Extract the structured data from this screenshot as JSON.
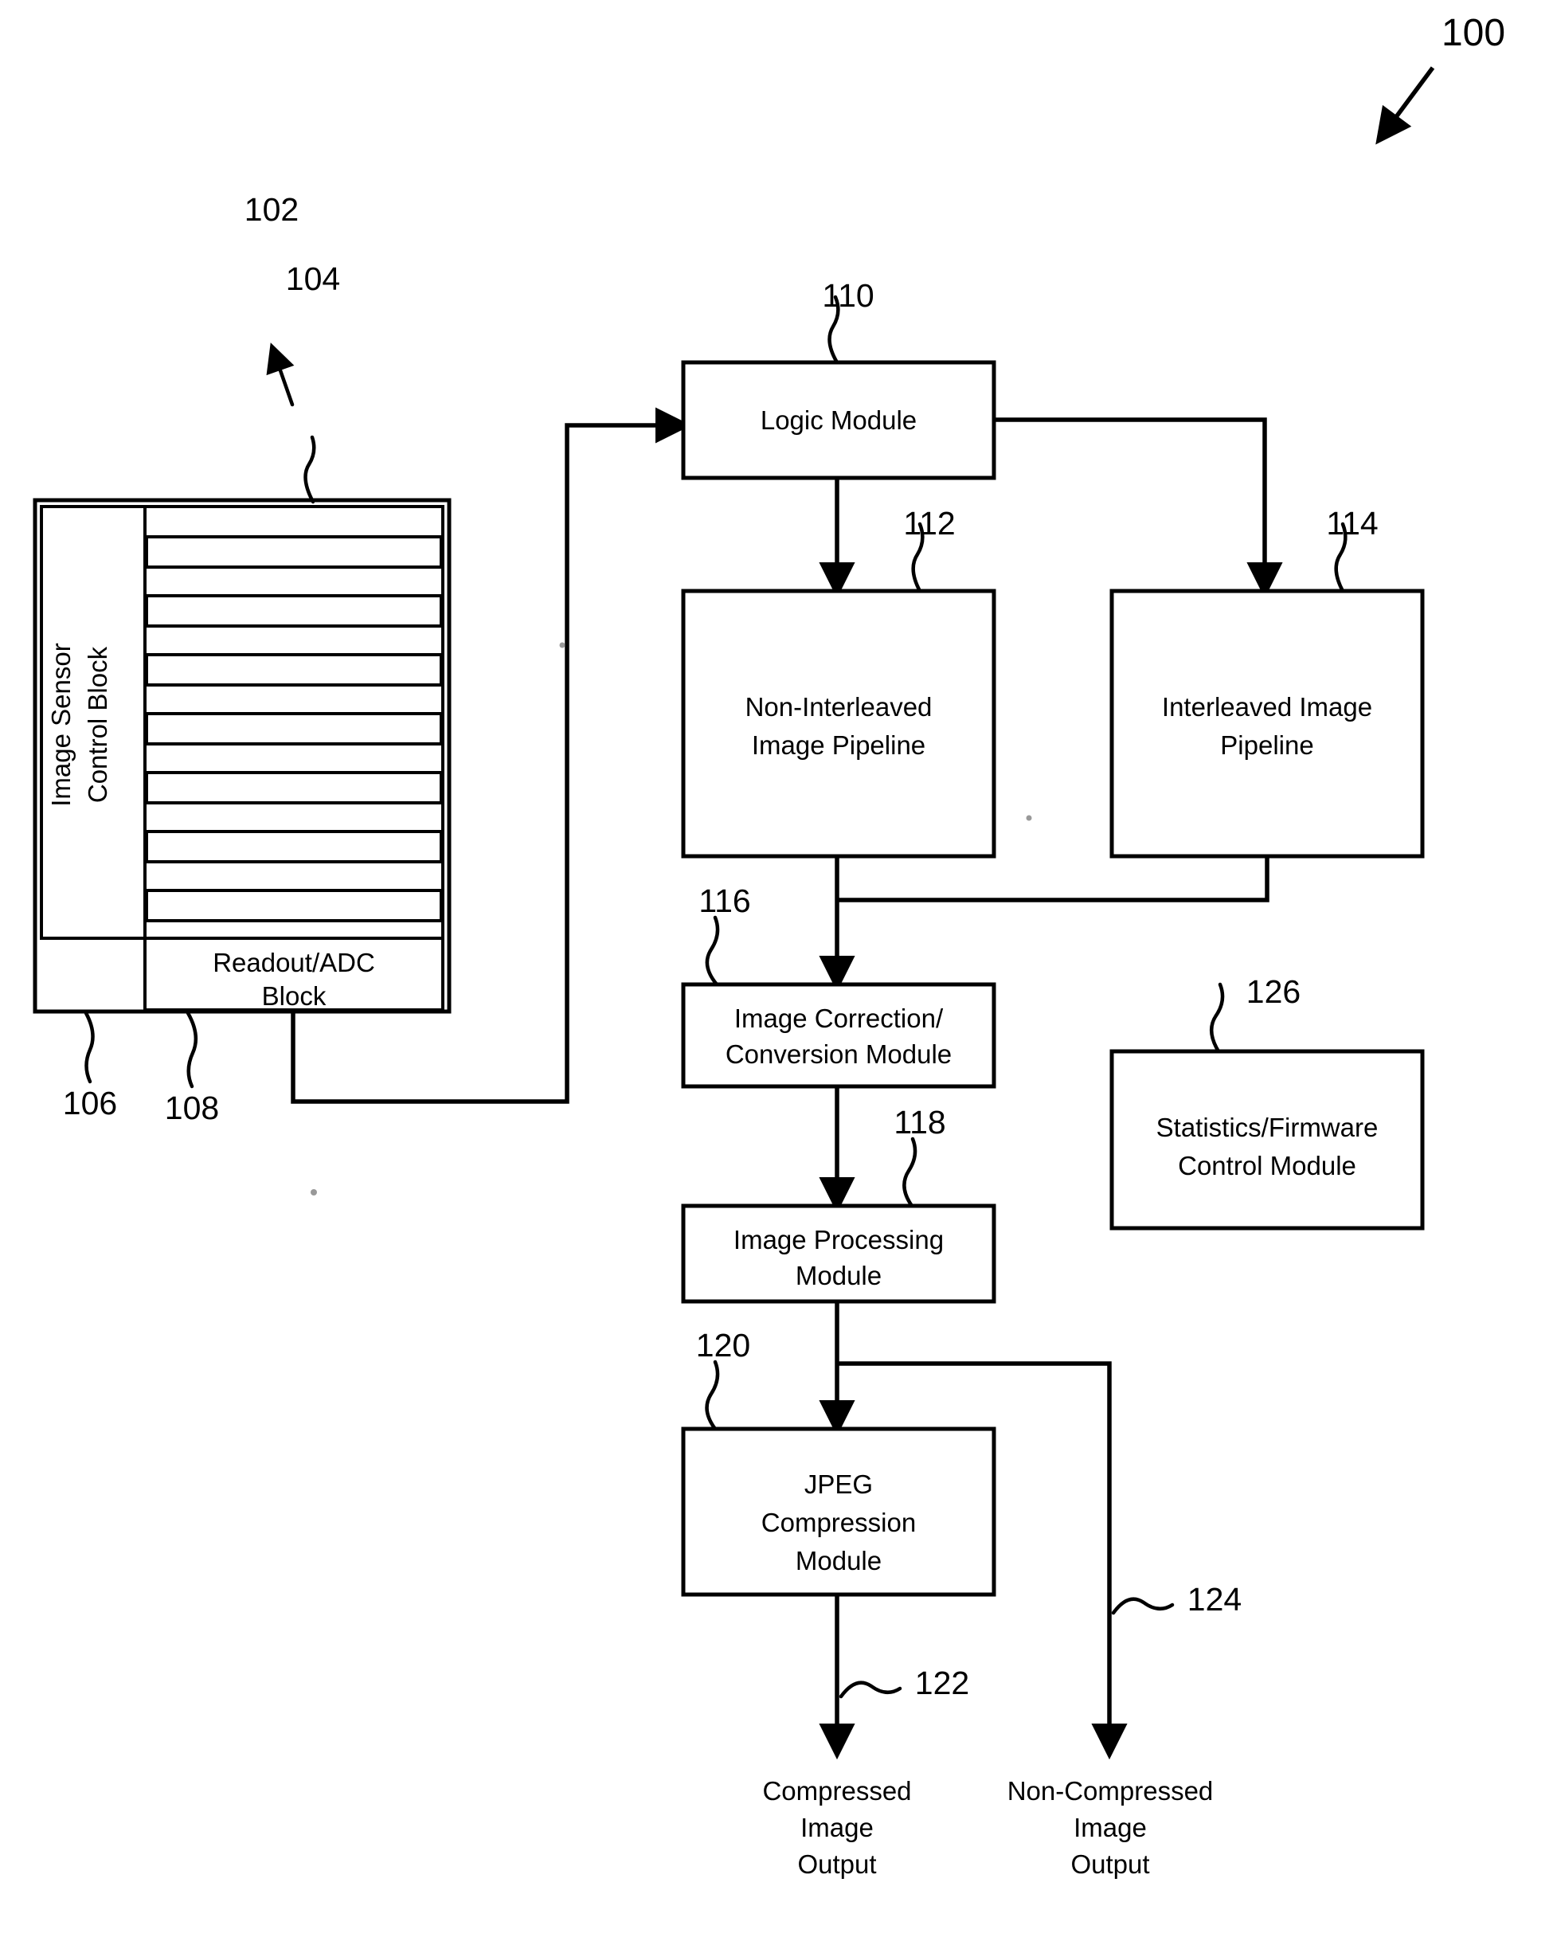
{
  "figure": {
    "figure_ref": "100",
    "blocks": {
      "sensor_assembly": {
        "ref": "102",
        "control_block_label_line1": "Image Sensor",
        "control_block_label_line2": "Control Block",
        "control_block_ref": "106",
        "pixel_array_ref": "104",
        "readout_label_line1": "Readout/ADC",
        "readout_label_line2": "Block",
        "readout_ref": "108",
        "stripe_rows": 17
      },
      "logic_module": {
        "ref": "110",
        "label": "Logic Module"
      },
      "non_interleaved_pipeline": {
        "ref": "112",
        "label_line1": "Non-Interleaved",
        "label_line2": "Image Pipeline"
      },
      "interleaved_pipeline": {
        "ref": "114",
        "label_line1": "Interleaved Image",
        "label_line2": "Pipeline"
      },
      "image_correction": {
        "ref": "116",
        "label_line1": "Image Correction/",
        "label_line2": "Conversion Module"
      },
      "image_processing": {
        "ref": "118",
        "label_line1": "Image Processing",
        "label_line2": "Module"
      },
      "jpeg_compression": {
        "ref": "120",
        "label_line1": "JPEG",
        "label_line2": "Compression",
        "label_line3": "Module"
      },
      "statistics_firmware": {
        "ref": "126",
        "label_line1": "Statistics/Firmware",
        "label_line2": "Control Module"
      }
    },
    "outputs": {
      "compressed": {
        "ref": "122",
        "line1": "Compressed",
        "line2": "Image",
        "line3": "Output"
      },
      "non_compressed": {
        "ref": "124",
        "line1": "Non-Compressed",
        "line2": "Image",
        "line3": "Output"
      }
    },
    "colors": {
      "ink": "#000000",
      "paper": "#ffffff",
      "stipple": "#9a9a9a"
    }
  }
}
